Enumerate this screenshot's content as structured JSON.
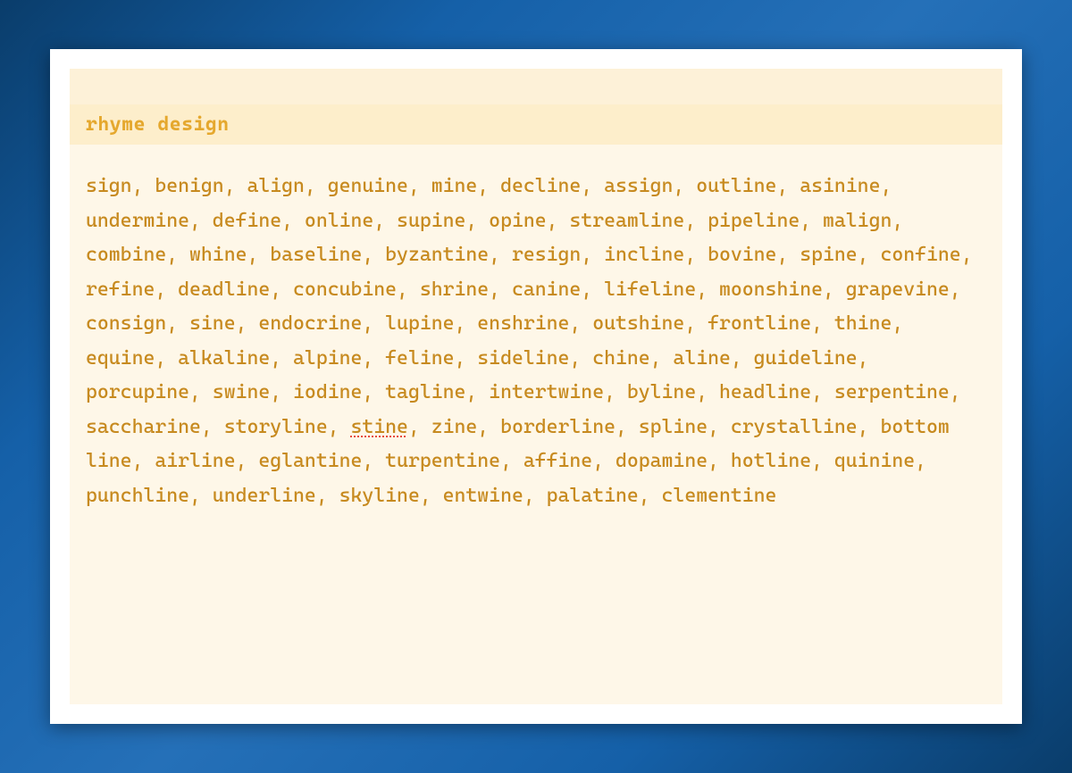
{
  "title": "rhyme design",
  "misspelled_word": "stine",
  "words": [
    "sign",
    "benign",
    "align",
    "genuine",
    "mine",
    "decline",
    "assign",
    "outline",
    "asinine",
    "undermine",
    "define",
    "online",
    "supine",
    "opine",
    "streamline",
    "pipeline",
    "malign",
    "combine",
    "whine",
    "baseline",
    "byzantine",
    "resign",
    "incline",
    "bovine",
    "spine",
    "confine",
    "refine",
    "deadline",
    "concubine",
    "shrine",
    "canine",
    "lifeline",
    "moonshine",
    "grapevine",
    "consign",
    "sine",
    "endocrine",
    "lupine",
    "enshrine",
    "outshine",
    "frontline",
    "thine",
    "equine",
    "alkaline",
    "alpine",
    "feline",
    "sideline",
    "chine",
    "aline",
    "guideline",
    "porcupine",
    "swine",
    "iodine",
    "tagline",
    "intertwine",
    "byline",
    "headline",
    "serpentine",
    "saccharine",
    "storyline",
    "stine",
    "zine",
    "borderline",
    "spline",
    "crystalline",
    "bottom line",
    "airline",
    "eglantine",
    "turpentine",
    "affine",
    "dopamine",
    "hotline",
    "quinine",
    "punchline",
    "underline",
    "skyline",
    "entwine",
    "palatine",
    "clementine"
  ]
}
